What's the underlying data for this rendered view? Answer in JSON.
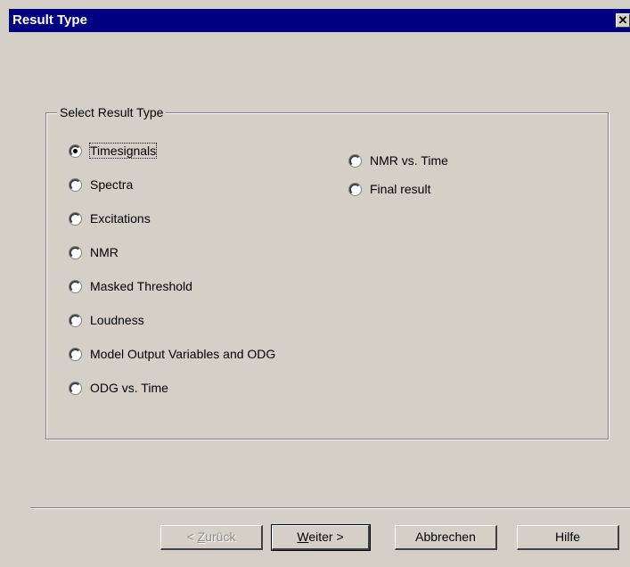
{
  "window": {
    "title": "Result Type",
    "close_label": "✕"
  },
  "group": {
    "label": "Select Result Type",
    "options": [
      {
        "label": "Timesignals",
        "selected": true
      },
      {
        "label": "Spectra",
        "selected": false
      },
      {
        "label": "Excitations",
        "selected": false
      },
      {
        "label": "NMR",
        "selected": false
      },
      {
        "label": "Masked Threshold",
        "selected": false
      },
      {
        "label": "Loudness",
        "selected": false
      },
      {
        "label": "Model Output Variables and ODG",
        "selected": false
      },
      {
        "label": "ODG vs. Time",
        "selected": false
      },
      {
        "label": "NMR vs. Time",
        "selected": false
      },
      {
        "label": "Final result",
        "selected": false
      }
    ]
  },
  "buttons": {
    "back": {
      "prefix": "< ",
      "mnemonic": "Z",
      "rest": "urück",
      "enabled": false
    },
    "next": {
      "mnemonic": "W",
      "rest": "eiter >",
      "enabled": true
    },
    "cancel": {
      "label": "Abbrechen"
    },
    "help": {
      "label": "Hilfe"
    }
  }
}
